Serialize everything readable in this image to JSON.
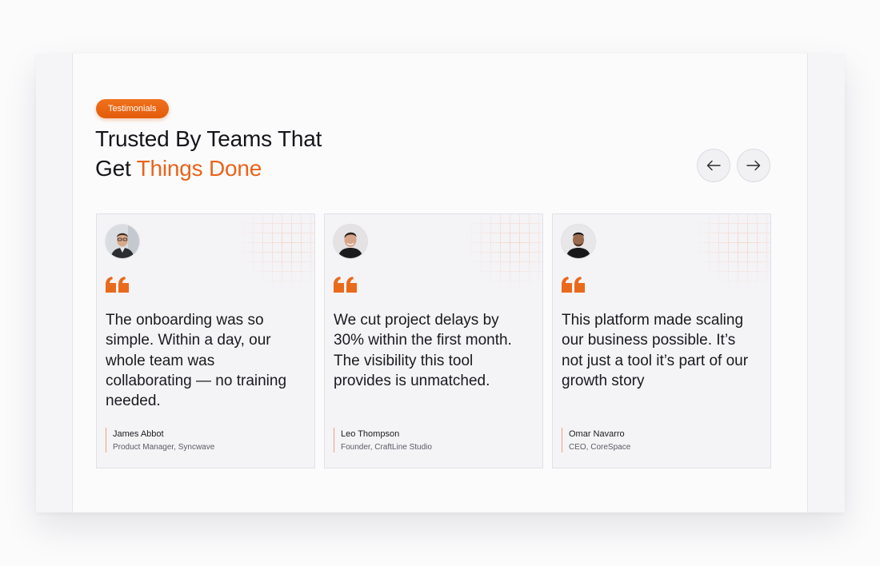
{
  "section": {
    "badge": "Testimonials",
    "title_line1": "Trusted By Teams That",
    "title_line2_plain": "Get ",
    "title_line2_accent": "Things Done"
  },
  "nav": {
    "prev_icon": "arrow-left-icon",
    "next_icon": "arrow-right-icon"
  },
  "colors": {
    "accent": "#e8641a",
    "text": "#15151a",
    "card_bg": "#f4f3f6"
  },
  "testimonials": [
    {
      "quote": "The onboarding was so simple. Within a day, our whole team was collaborating — no training needed.",
      "name": "James Abbot",
      "role": "Product Manager, Syncwave"
    },
    {
      "quote": "We cut project delays by 30% within the first month. The visibility this tool provides is unmatched.",
      "name": "Leo Thompson",
      "role": "Founder, CraftLine Studio"
    },
    {
      "quote": "This platform made scaling our business possible. It’s not just a tool it’s part of our growth story",
      "name": "Omar Navarro",
      "role": "CEO, CoreSpace"
    }
  ]
}
